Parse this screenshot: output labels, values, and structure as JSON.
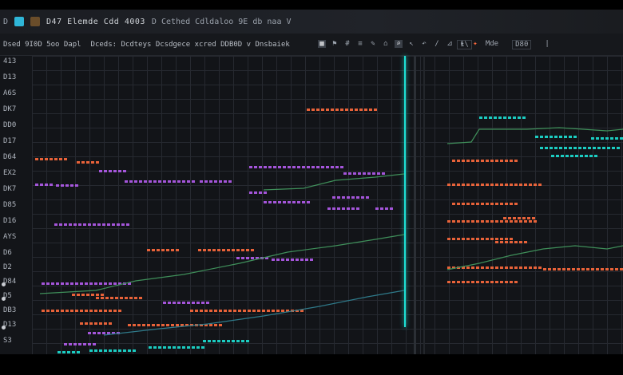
{
  "titlebar": {
    "glyph": "D",
    "app_icon_1": "app-icon-cyan",
    "app_icon_2": "app-icon-orange",
    "title": "D47 Elemde Cdd 4003",
    "subtitle": "D Cethed Cdldaloo 9E db naa V"
  },
  "toolbar": {
    "label_1": "Dsed 9I0D 5oo Dapl",
    "label_2": "Dceds: Dcdteys Dcsdgece xcred DDB0D v Dnsbaiek",
    "icons": [
      "grid-icon",
      "flag-icon",
      "hash-icon",
      "bars-icon",
      "edit-icon",
      "tag-icon",
      "zoom-icon",
      "pointer-icon",
      "undo-icon",
      "pen-icon",
      "ruler-icon",
      "flag-small-icon",
      "warn-icon"
    ],
    "right_items": [
      "1\\",
      "Mde",
      "D80",
      "|"
    ]
  },
  "y_ticks": [
    "413",
    "D13",
    "A6S",
    "DK7",
    "DD0",
    "D17",
    "D64",
    "EX2",
    "DK7",
    "D85",
    "D16",
    "AYS",
    "D6",
    "D2",
    "D84",
    "D5",
    "DB3",
    "D13",
    "S3"
  ],
  "colors": {
    "cyan": "#1de0d4",
    "magenta": "#b55cf0",
    "orange": "#ff6a3d",
    "green": "#3f8f5a"
  }
}
